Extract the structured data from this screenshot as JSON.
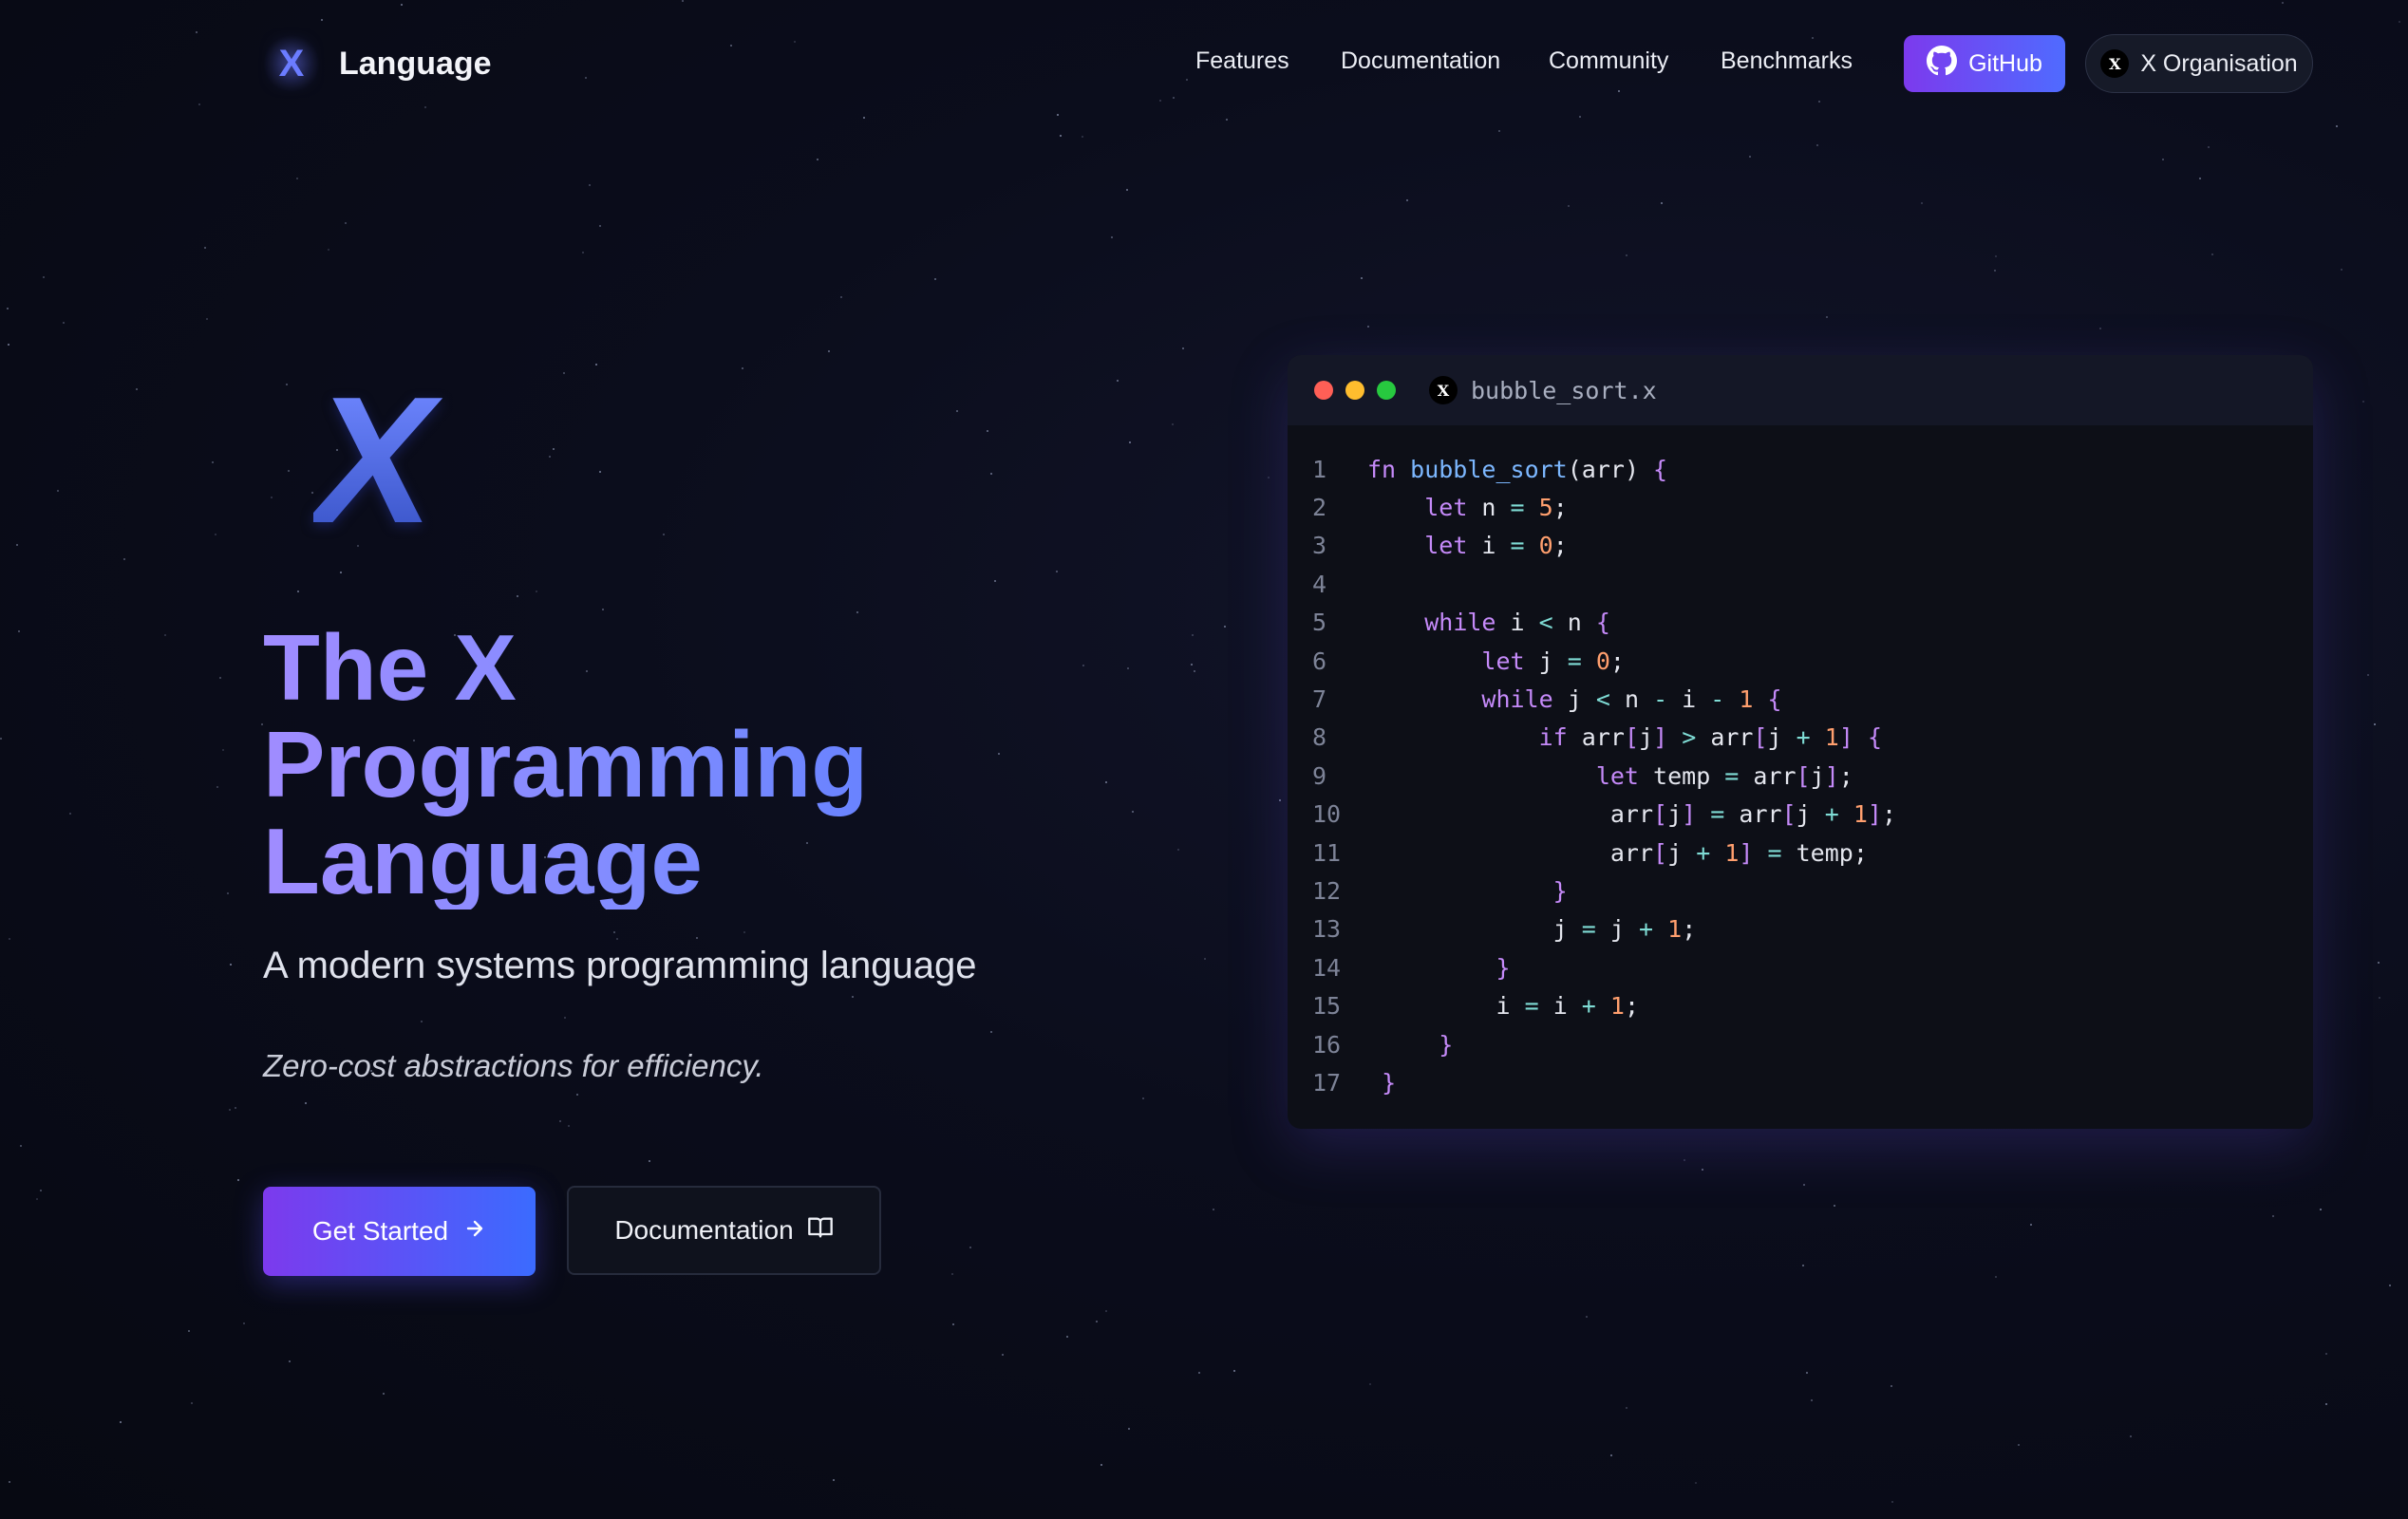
{
  "nav": {
    "brand_mark": "X",
    "brand_name": "Language",
    "links": [
      "Features",
      "Documentation",
      "Community",
      "Benchmarks"
    ],
    "github_label": "GitHub",
    "org_badge": "X",
    "org_label": "X Organisation"
  },
  "hero": {
    "logo": "X",
    "title_line1": "The X",
    "title_line2": "Programming",
    "title_line3": "Language",
    "subtitle": "A modern systems programming language",
    "tagline": "Zero-cost abstractions for efficiency.",
    "cta_primary": "Get Started",
    "cta_secondary": "Documentation"
  },
  "code_window": {
    "badge": "X",
    "file_name": "bubble_sort.x",
    "lines": [
      {
        "n": "1",
        "tokens": [
          [
            "kw",
            "fn "
          ],
          [
            "fnn",
            "bubble_sort"
          ],
          [
            "id",
            "(arr) "
          ],
          [
            "pn",
            "{"
          ]
        ]
      },
      {
        "n": "2",
        "tokens": [
          [
            "id",
            "    "
          ],
          [
            "kw",
            "let"
          ],
          [
            "id",
            " n "
          ],
          [
            "op",
            "="
          ],
          [
            "id",
            " "
          ],
          [
            "num",
            "5"
          ],
          [
            "id",
            ";"
          ]
        ]
      },
      {
        "n": "3",
        "tokens": [
          [
            "id",
            "    "
          ],
          [
            "kw",
            "let"
          ],
          [
            "id",
            " i "
          ],
          [
            "op",
            "="
          ],
          [
            "id",
            " "
          ],
          [
            "num",
            "0"
          ],
          [
            "id",
            ";"
          ]
        ]
      },
      {
        "n": "4",
        "tokens": []
      },
      {
        "n": "5",
        "tokens": [
          [
            "id",
            "    "
          ],
          [
            "kw",
            "while"
          ],
          [
            "id",
            " i "
          ],
          [
            "op",
            "<"
          ],
          [
            "id",
            " n "
          ],
          [
            "pn",
            "{"
          ]
        ]
      },
      {
        "n": "6",
        "tokens": [
          [
            "id",
            "        "
          ],
          [
            "kw",
            "let"
          ],
          [
            "id",
            " j "
          ],
          [
            "op",
            "="
          ],
          [
            "id",
            " "
          ],
          [
            "num",
            "0"
          ],
          [
            "id",
            ";"
          ]
        ]
      },
      {
        "n": "7",
        "tokens": [
          [
            "id",
            "        "
          ],
          [
            "kw",
            "while"
          ],
          [
            "id",
            " j "
          ],
          [
            "op",
            "<"
          ],
          [
            "id",
            " n "
          ],
          [
            "op",
            "-"
          ],
          [
            "id",
            " i "
          ],
          [
            "op",
            "-"
          ],
          [
            "id",
            " "
          ],
          [
            "num",
            "1"
          ],
          [
            "id",
            " "
          ],
          [
            "pn",
            "{"
          ]
        ]
      },
      {
        "n": "8",
        "tokens": [
          [
            "id",
            "            "
          ],
          [
            "kw",
            "if"
          ],
          [
            "id",
            " arr"
          ],
          [
            "pn",
            "["
          ],
          [
            "id",
            "j"
          ],
          [
            "pn",
            "]"
          ],
          [
            "id",
            " "
          ],
          [
            "op",
            ">"
          ],
          [
            "id",
            " arr"
          ],
          [
            "pn",
            "["
          ],
          [
            "id",
            "j "
          ],
          [
            "op",
            "+"
          ],
          [
            "id",
            " "
          ],
          [
            "num",
            "1"
          ],
          [
            "pn",
            "]"
          ],
          [
            "id",
            " "
          ],
          [
            "pn",
            "{"
          ]
        ]
      },
      {
        "n": "9",
        "tokens": [
          [
            "id",
            "                "
          ],
          [
            "kw",
            "let"
          ],
          [
            "id",
            " temp "
          ],
          [
            "op",
            "="
          ],
          [
            "id",
            " arr"
          ],
          [
            "pn",
            "["
          ],
          [
            "id",
            "j"
          ],
          [
            "pn",
            "]"
          ],
          [
            "id",
            ";"
          ]
        ]
      },
      {
        "n": "10",
        "tokens": [
          [
            "id",
            "                 arr"
          ],
          [
            "pn",
            "["
          ],
          [
            "id",
            "j"
          ],
          [
            "pn",
            "]"
          ],
          [
            "id",
            " "
          ],
          [
            "op",
            "="
          ],
          [
            "id",
            " arr"
          ],
          [
            "pn",
            "["
          ],
          [
            "id",
            "j "
          ],
          [
            "op",
            "+"
          ],
          [
            "id",
            " "
          ],
          [
            "num",
            "1"
          ],
          [
            "pn",
            "]"
          ],
          [
            "id",
            ";"
          ]
        ]
      },
      {
        "n": "11",
        "tokens": [
          [
            "id",
            "                 arr"
          ],
          [
            "pn",
            "["
          ],
          [
            "id",
            "j "
          ],
          [
            "op",
            "+"
          ],
          [
            "id",
            " "
          ],
          [
            "num",
            "1"
          ],
          [
            "pn",
            "]"
          ],
          [
            "id",
            " "
          ],
          [
            "op",
            "="
          ],
          [
            "id",
            " temp;"
          ]
        ]
      },
      {
        "n": "12",
        "tokens": [
          [
            "id",
            "             "
          ],
          [
            "pn",
            "}"
          ]
        ]
      },
      {
        "n": "13",
        "tokens": [
          [
            "id",
            "             j "
          ],
          [
            "op",
            "="
          ],
          [
            "id",
            " j "
          ],
          [
            "op",
            "+"
          ],
          [
            "id",
            " "
          ],
          [
            "num",
            "1"
          ],
          [
            "id",
            ";"
          ]
        ]
      },
      {
        "n": "14",
        "tokens": [
          [
            "id",
            "         "
          ],
          [
            "pn",
            "}"
          ]
        ]
      },
      {
        "n": "15",
        "tokens": [
          [
            "id",
            "         i "
          ],
          [
            "op",
            "="
          ],
          [
            "id",
            " i "
          ],
          [
            "op",
            "+"
          ],
          [
            "id",
            " "
          ],
          [
            "num",
            "1"
          ],
          [
            "id",
            ";"
          ]
        ]
      },
      {
        "n": "16",
        "tokens": [
          [
            "id",
            "     "
          ],
          [
            "pn",
            "}"
          ]
        ]
      },
      {
        "n": "17",
        "tokens": [
          [
            "id",
            " "
          ],
          [
            "pn",
            "}"
          ]
        ]
      }
    ]
  },
  "colors": {
    "accent_purple": "#7c3aed",
    "accent_blue": "#3b6bff",
    "dot_red": "#ff5f56",
    "dot_yellow": "#ffbd2e",
    "dot_green": "#27c93f"
  }
}
